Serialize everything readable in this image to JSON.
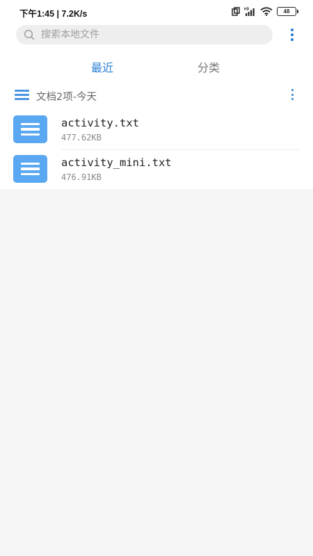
{
  "status_bar": {
    "time_speed": "下午1:45 | 7.2K/s",
    "battery": "48"
  },
  "search": {
    "placeholder": "搜索本地文件"
  },
  "tabs": [
    {
      "label": "最近",
      "active": true
    },
    {
      "label": "分类",
      "active": false
    }
  ],
  "section": {
    "title": "文档2项-今天"
  },
  "files": [
    {
      "name": "activity.txt",
      "size": "477.62KB"
    },
    {
      "name": "activity_mini.txt",
      "size": "476.91KB"
    }
  ],
  "colors": {
    "accent": "#2a7fd4",
    "file_icon": "#5aa8f2",
    "page_bg": "#f5f5f5"
  }
}
